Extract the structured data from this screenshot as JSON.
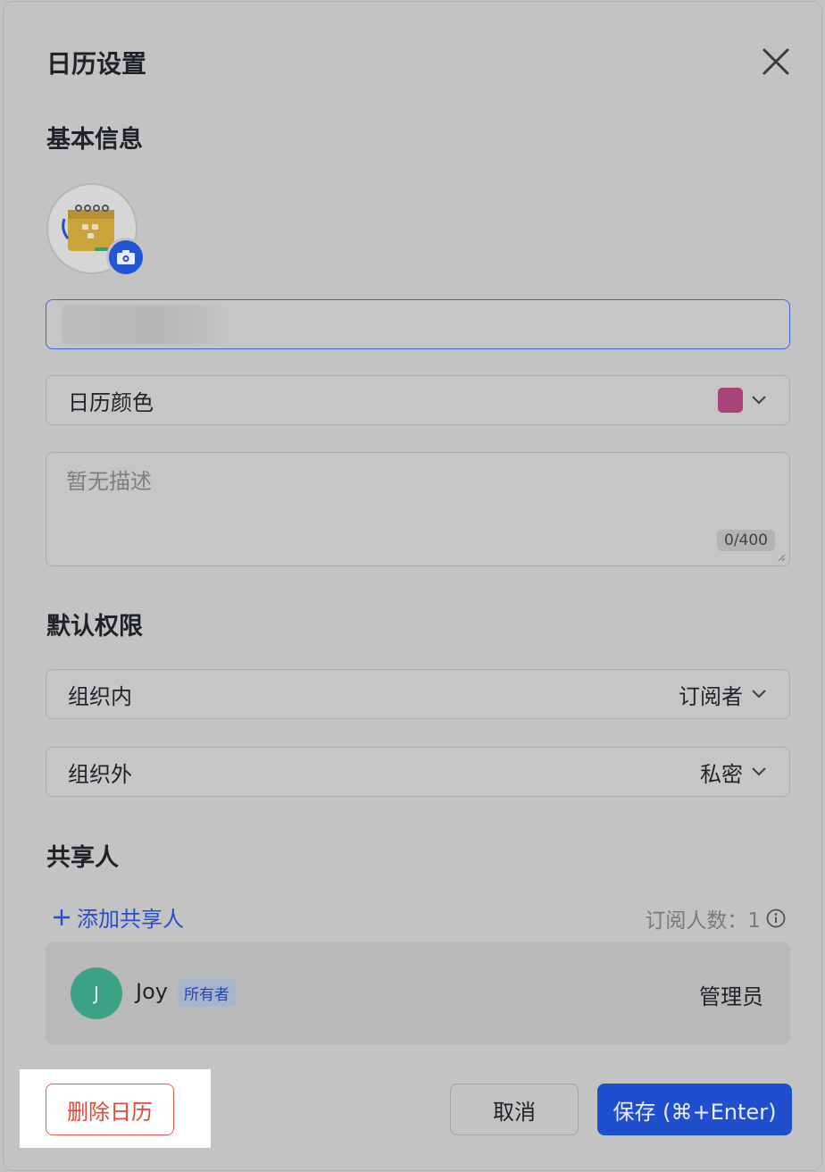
{
  "dialog": {
    "title": "日历设置"
  },
  "basic_info": {
    "heading": "基本信息",
    "color_label": "日历颜色",
    "color_value": "#a8447a",
    "description_placeholder": "暂无描述",
    "description_counter": "0/400"
  },
  "permissions": {
    "heading": "默认权限",
    "inside_label": "组织内",
    "inside_value": "订阅者",
    "outside_label": "组织外",
    "outside_value": "私密"
  },
  "sharing": {
    "heading": "共享人",
    "add_label": "添加共享人",
    "subscriber_count_label": "订阅人数：1",
    "members": [
      {
        "initial": "J",
        "name": "Joy",
        "badge": "所有者",
        "role": "管理员"
      }
    ]
  },
  "footer": {
    "delete_label": "删除日历",
    "cancel_label": "取消",
    "save_label": "保存 (⌘+Enter)"
  },
  "colors": {
    "primary": "#1f4fcf",
    "danger": "#e14a39",
    "avatar": "#3aa283"
  }
}
